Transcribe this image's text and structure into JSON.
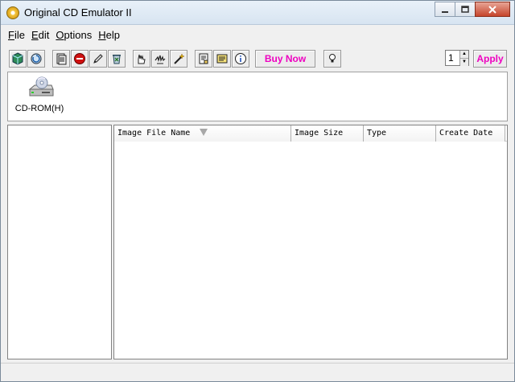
{
  "window": {
    "title": "Original CD Emulator II"
  },
  "menu": [
    {
      "accel": "F",
      "rest": "ile"
    },
    {
      "accel": "E",
      "rest": "dit"
    },
    {
      "accel": "O",
      "rest": "ptions"
    },
    {
      "accel": "H",
      "rest": "elp"
    }
  ],
  "toolbar": {
    "buy_now_label": "Buy Now",
    "apply_label": "Apply",
    "spinner_value": "1"
  },
  "drives": [
    {
      "label": "CD-ROM(H)",
      "icon": "cd-drive-icon"
    }
  ],
  "image_list": {
    "columns": [
      "Image File Name",
      "Image Size",
      "Type",
      "Create Date"
    ],
    "sort_column": "Image File Name",
    "rows": []
  },
  "colors": {
    "accent_text": "#ee00c0",
    "title_bar": "#d7e4f1"
  }
}
